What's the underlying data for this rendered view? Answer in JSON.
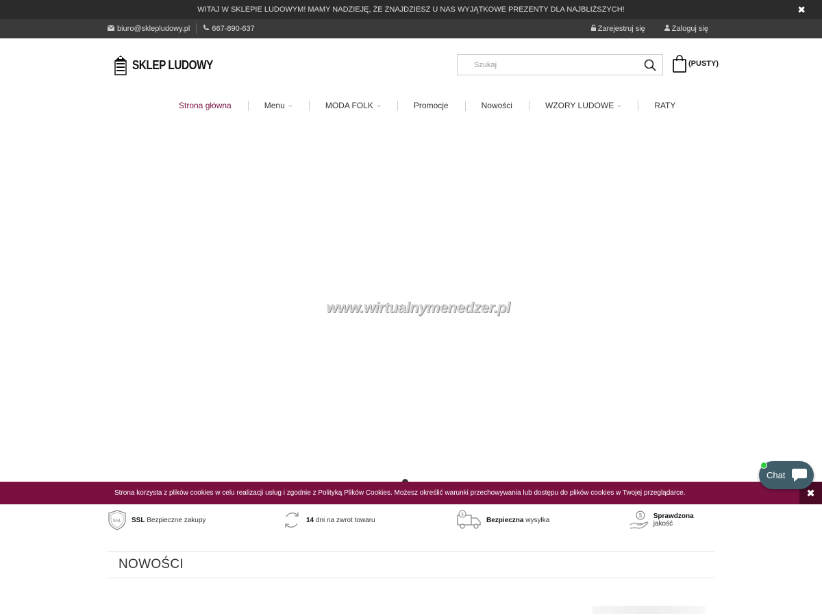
{
  "announcement": {
    "text": "WITAJ W SKLEPIE LUDOWYM! MAMY NADZIEJĘ, ŻE ZNAJDZIESZ U NAS WYJĄTKOWE PREZENTY DLA NAJBLIŻSZYCH!",
    "close_icon": "close-icon"
  },
  "contact": {
    "email": "biuro@sklepludowy.pl",
    "phone": "667-890-637"
  },
  "account": {
    "register": "Zarejestruj się",
    "login": "Zaloguj się"
  },
  "logo": {
    "text": "SKLEP LUDOWY"
  },
  "search": {
    "placeholder": "Szukaj"
  },
  "cart": {
    "label": "(PUSTY)"
  },
  "nav": {
    "items": [
      {
        "label": "Strona główna",
        "dropdown": false,
        "active": true
      },
      {
        "label": "Menu",
        "dropdown": true
      },
      {
        "label": "MODA FOLK",
        "dropdown": true
      },
      {
        "label": "Promocje",
        "dropdown": false
      },
      {
        "label": "Nowości",
        "dropdown": false
      },
      {
        "label": "WZORY LUDOWE",
        "dropdown": true
      },
      {
        "label": "RATY",
        "dropdown": false
      }
    ]
  },
  "hero": {
    "watermark": "www.wirtualnymenedzer.pl"
  },
  "cookie": {
    "text": "Strona korzysta z plików cookies w celu realizacji usług i zgodnie z Polityką Plików Cookies. Możesz określić warunki przechowywania lub dostępu do plików cookies w Twojej przeglądarce."
  },
  "chat": {
    "label": "Chat"
  },
  "features": [
    {
      "bold": "SSL",
      "text": "Bezpieczne zakupy",
      "icon": "shield-ssl-icon"
    },
    {
      "bold": "14",
      "text": "dni na zwrot towaru",
      "icon": "return-arrows-icon"
    },
    {
      "bold": "Bezpieczna",
      "text": "wysyłka",
      "icon": "delivery-truck-icon"
    },
    {
      "bold": "Sprawdzona",
      "text": "jakość",
      "icon": "hand-coin-icon"
    }
  ],
  "section": {
    "title": "NOWOŚCI"
  },
  "colors": {
    "accent": "#7a1040",
    "topbar": "#2b2b2b",
    "contactbar": "#3a3a3a",
    "chat": "#3f5e6a"
  }
}
